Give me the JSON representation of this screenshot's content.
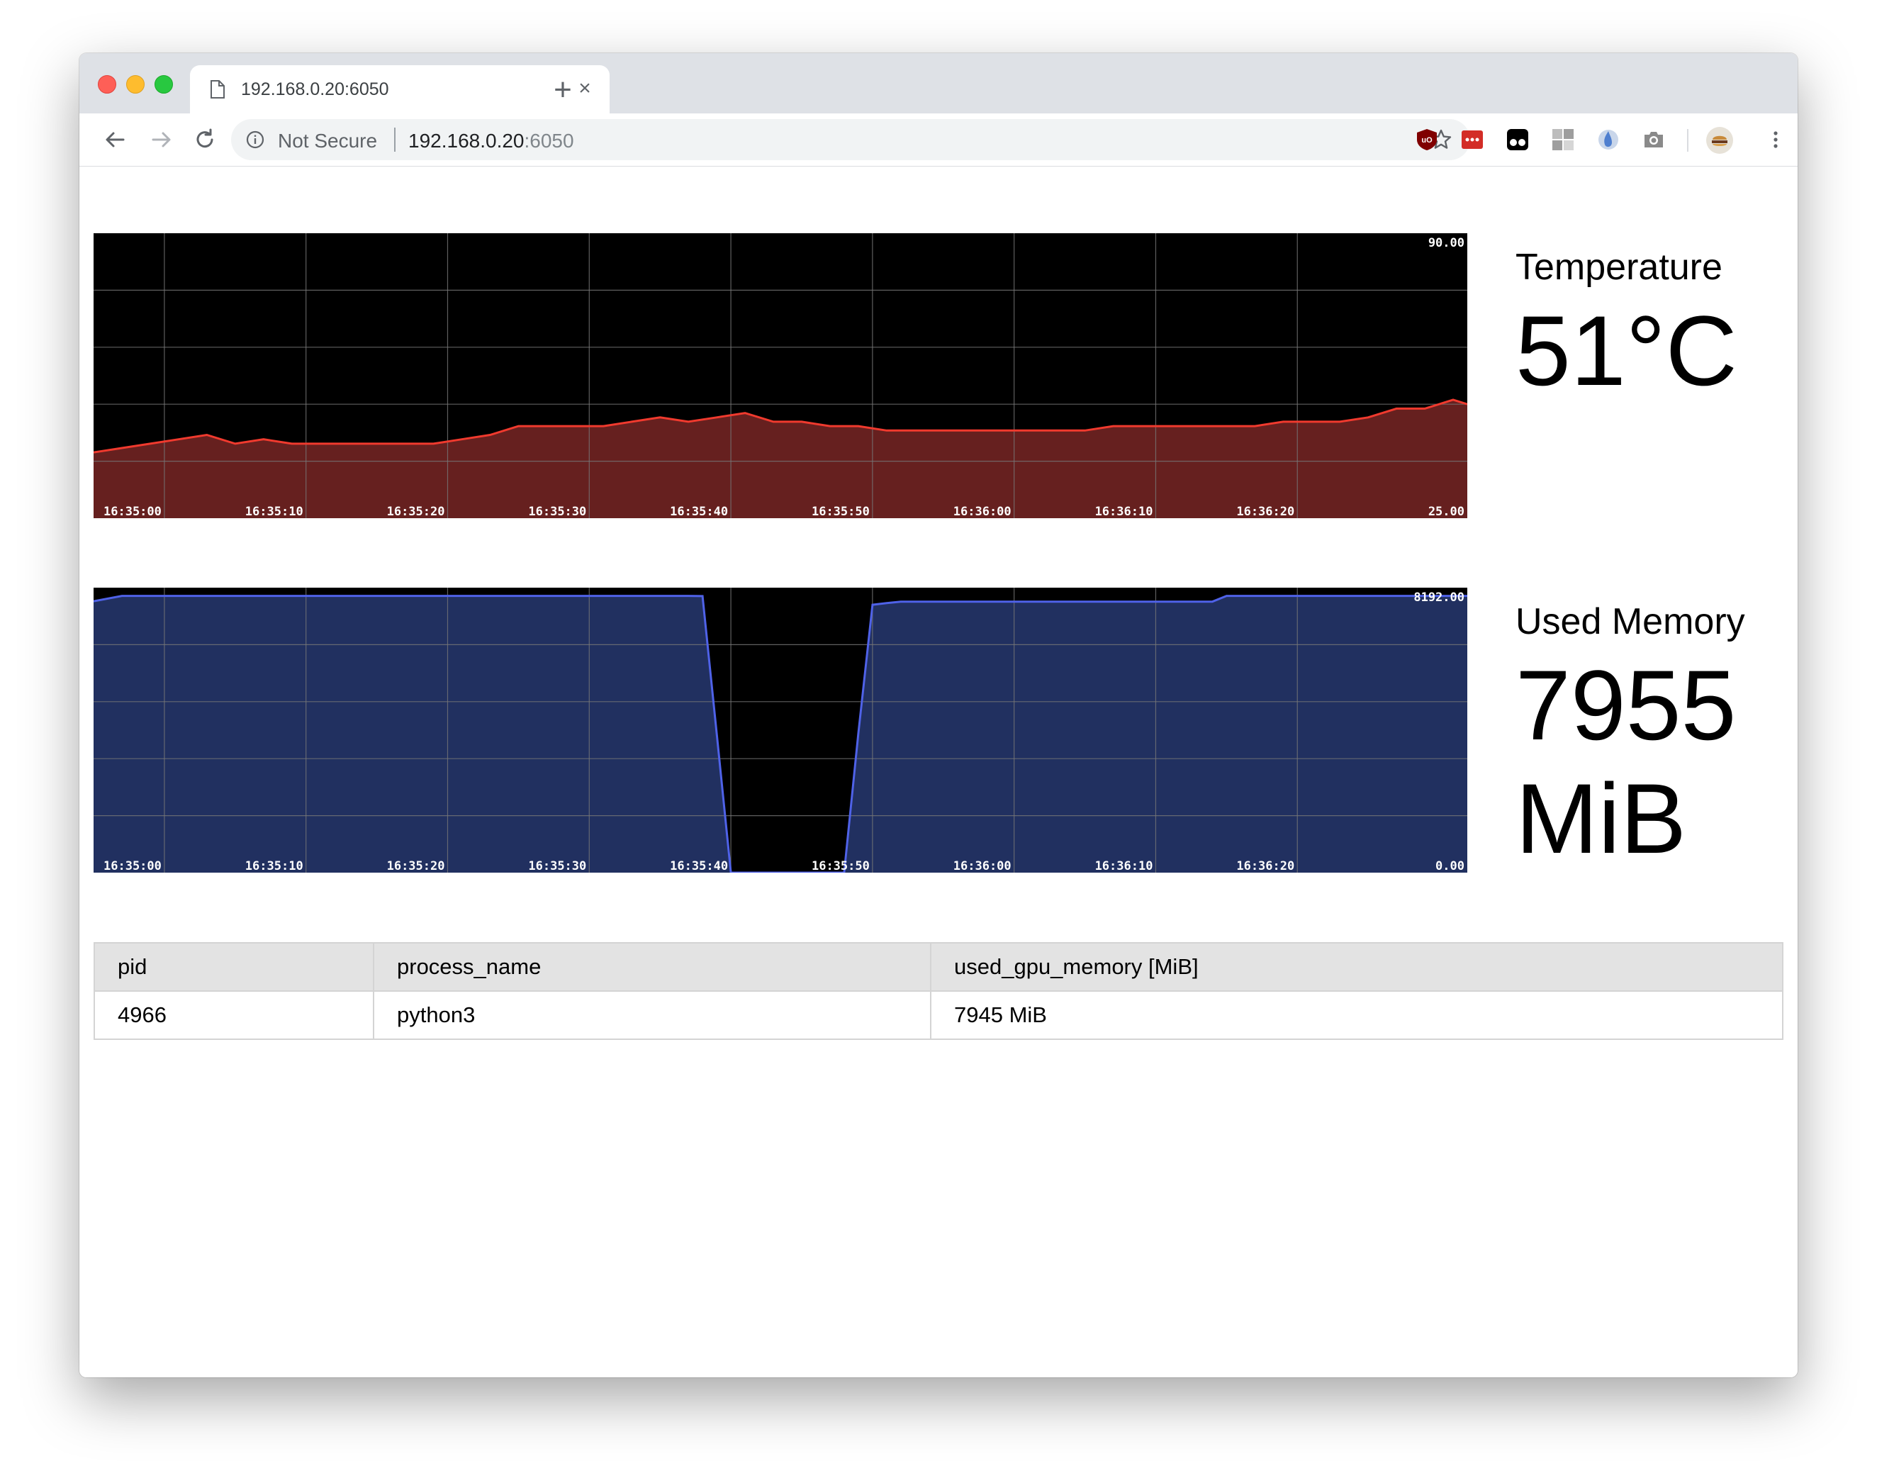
{
  "browser": {
    "tab_title": "192.168.0.20:6050",
    "tab_close_glyph": "×",
    "new_tab_glyph": "+",
    "security_label": "Not Secure",
    "url_host": "192.168.0.20",
    "url_port": ":6050",
    "icons": [
      "back-arrow-icon",
      "forward-arrow-icon",
      "reload-icon",
      "info-icon",
      "star-icon",
      "ublock-icon",
      "lastpass-icon",
      "tampermonkey-icon",
      "extension-grid-icon",
      "drop-icon",
      "camera-icon",
      "profile-avatar-icon",
      "kebab-menu-icon"
    ]
  },
  "temperature": {
    "label": "Temperature",
    "value": "51°C"
  },
  "memory": {
    "label": "Used Memory",
    "value": "7955 MiB"
  },
  "table": {
    "headers": [
      "pid",
      "process_name",
      "used_gpu_memory [MiB]"
    ],
    "rows": [
      [
        "4966",
        "python3",
        "7945 MiB"
      ]
    ]
  },
  "chart_data": [
    {
      "type": "area",
      "ylim": [
        25,
        90
      ],
      "ytick_labels": [
        "90.00",
        "25.00"
      ],
      "xtick_labels": [
        "16:35:00",
        "16:35:10",
        "16:35:20",
        "16:35:30",
        "16:35:40",
        "16:35:50",
        "16:36:00",
        "16:36:10",
        "16:36:20"
      ],
      "grid": true,
      "colors": {
        "line": "#f03a2e",
        "fill": "#66201f",
        "background": "#000000",
        "grid": "#777777"
      },
      "x": [
        "16:34:55",
        "16:34:57",
        "16:34:59",
        "16:35:01",
        "16:35:03",
        "16:35:05",
        "16:35:07",
        "16:35:09",
        "16:35:11",
        "16:35:13",
        "16:35:15",
        "16:35:17",
        "16:35:19",
        "16:35:21",
        "16:35:23",
        "16:35:25",
        "16:35:27",
        "16:35:29",
        "16:35:31",
        "16:35:33",
        "16:35:35",
        "16:35:37",
        "16:35:39",
        "16:35:41",
        "16:35:43",
        "16:35:45",
        "16:35:47",
        "16:35:49",
        "16:35:51",
        "16:35:53",
        "16:35:55",
        "16:35:57",
        "16:35:59",
        "16:36:01",
        "16:36:03",
        "16:36:05",
        "16:36:07",
        "16:36:09",
        "16:36:11",
        "16:36:13",
        "16:36:15",
        "16:36:17",
        "16:36:19",
        "16:36:21",
        "16:36:23",
        "16:36:25",
        "16:36:27",
        "16:36:29",
        "16:36:31",
        "16:36:32"
      ],
      "values": [
        40,
        41,
        42,
        43,
        44,
        42,
        43,
        42,
        42,
        42,
        42,
        42,
        42,
        43,
        44,
        46,
        46,
        46,
        46,
        47,
        48,
        47,
        48,
        49,
        47,
        47,
        46,
        46,
        45,
        45,
        45,
        45,
        45,
        45,
        45,
        45,
        46,
        46,
        46,
        46,
        46,
        46,
        47,
        47,
        47,
        48,
        50,
        50,
        52,
        51
      ]
    },
    {
      "type": "area",
      "ylim": [
        0,
        8192
      ],
      "ytick_labels": [
        "8192.00",
        "0.00"
      ],
      "xtick_labels": [
        "16:35:00",
        "16:35:10",
        "16:35:20",
        "16:35:30",
        "16:35:40",
        "16:35:50",
        "16:36:00",
        "16:36:10",
        "16:36:20"
      ],
      "grid": true,
      "colors": {
        "line": "#4f62e8",
        "fill": "#213060",
        "background": "#000000",
        "grid": "#777777"
      },
      "x": [
        "16:34:55",
        "16:34:57",
        "16:35:37",
        "16:35:38",
        "16:35:39",
        "16:35:40",
        "16:35:41",
        "16:35:45",
        "16:35:48",
        "16:35:49",
        "16:35:50",
        "16:35:51",
        "16:35:52",
        "16:36:10",
        "16:36:14",
        "16:36:15",
        "16:36:32"
      ],
      "values": [
        7800,
        7955,
        7955,
        7950,
        4000,
        0,
        0,
        0,
        0,
        4000,
        7700,
        7750,
        7790,
        7790,
        7790,
        7955,
        7955
      ]
    }
  ]
}
